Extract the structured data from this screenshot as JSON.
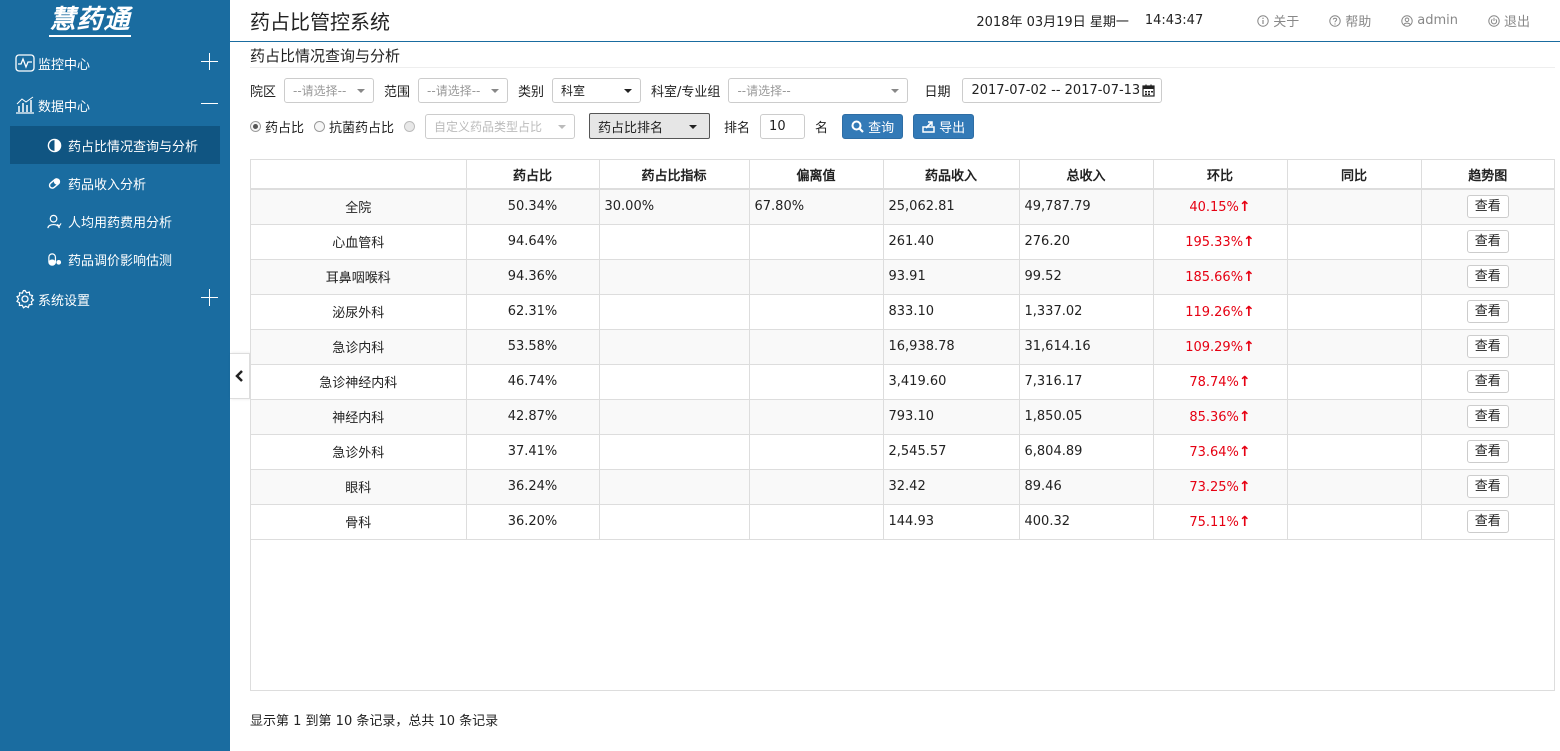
{
  "sidebar": {
    "logo": "慧药通",
    "groups": [
      {
        "label": "监控中心"
      },
      {
        "label": "数据中心"
      },
      {
        "label": "系统设置"
      }
    ],
    "sub_items": [
      {
        "label": "药占比情况查询与分析"
      },
      {
        "label": "药品收入分析"
      },
      {
        "label": "人均用药费用分析"
      },
      {
        "label": "药品调价影响估测"
      }
    ]
  },
  "header": {
    "title": "药占比管控系统",
    "date": "2018年 03月19日 星期一",
    "time": "14:43:47",
    "links": {
      "about": "关于",
      "help": "帮助",
      "user": "admin",
      "logout": "退出"
    }
  },
  "page": {
    "title": "药占比情况查询与分析"
  },
  "filters": {
    "campus_label": "院区",
    "campus_value": "--请选择--",
    "scope_label": "范围",
    "scope_value": "--请选择--",
    "category_label": "类别",
    "category_value": "科室",
    "dept_label": "科室/专业组",
    "dept_value": "--请选择--",
    "date_label": "日期",
    "date_value": "2017-07-02 -- 2017-07-13",
    "radio_drug": "药占比",
    "radio_antibiotic": "抗菌药占比",
    "custom_placeholder": "自定义药品类型占比",
    "rank_select": "药占比排名",
    "rank_label": "排名",
    "rank_value": "10",
    "rank_unit": "名",
    "query_button": "查询",
    "export_button": "导出"
  },
  "table": {
    "headers": [
      "",
      "药占比",
      "药占比指标",
      "偏离值",
      "药品收入",
      "总收入",
      "环比",
      "同比",
      "趋势图"
    ],
    "view_label": "查看",
    "rows": [
      {
        "name": "全院",
        "ratio": "50.34%",
        "target": "30.00%",
        "deviation": "67.80%",
        "drug_income": "25,062.81",
        "total_income": "49,787.79",
        "mom": "40.15%",
        "yoy": ""
      },
      {
        "name": "心血管科",
        "ratio": "94.64%",
        "target": "",
        "deviation": "",
        "drug_income": "261.40",
        "total_income": "276.20",
        "mom": "195.33%",
        "yoy": ""
      },
      {
        "name": "耳鼻咽喉科",
        "ratio": "94.36%",
        "target": "",
        "deviation": "",
        "drug_income": "93.91",
        "total_income": "99.52",
        "mom": "185.66%",
        "yoy": ""
      },
      {
        "name": "泌尿外科",
        "ratio": "62.31%",
        "target": "",
        "deviation": "",
        "drug_income": "833.10",
        "total_income": "1,337.02",
        "mom": "119.26%",
        "yoy": ""
      },
      {
        "name": "急诊内科",
        "ratio": "53.58%",
        "target": "",
        "deviation": "",
        "drug_income": "16,938.78",
        "total_income": "31,614.16",
        "mom": "109.29%",
        "yoy": ""
      },
      {
        "name": "急诊神经内科",
        "ratio": "46.74%",
        "target": "",
        "deviation": "",
        "drug_income": "3,419.60",
        "total_income": "7,316.17",
        "mom": "78.74%",
        "yoy": ""
      },
      {
        "name": "神经内科",
        "ratio": "42.87%",
        "target": "",
        "deviation": "",
        "drug_income": "793.10",
        "total_income": "1,850.05",
        "mom": "85.36%",
        "yoy": ""
      },
      {
        "name": "急诊外科",
        "ratio": "37.41%",
        "target": "",
        "deviation": "",
        "drug_income": "2,545.57",
        "total_income": "6,804.89",
        "mom": "73.64%",
        "yoy": ""
      },
      {
        "name": "眼科",
        "ratio": "36.24%",
        "target": "",
        "deviation": "",
        "drug_income": "32.42",
        "total_income": "89.46",
        "mom": "73.25%",
        "yoy": ""
      },
      {
        "name": "骨科",
        "ratio": "36.20%",
        "target": "",
        "deviation": "",
        "drug_income": "144.93",
        "total_income": "400.32",
        "mom": "75.11%",
        "yoy": ""
      }
    ]
  },
  "footer": {
    "summary": "显示第 1 到第 10 条记录，总共 10 条记录"
  },
  "colors": {
    "sidebar": "#1a6ca0",
    "active": "#105582",
    "primary_button": "#337ab7",
    "increase": "#e60012"
  },
  "icons": {
    "arrow_up": "↑"
  }
}
